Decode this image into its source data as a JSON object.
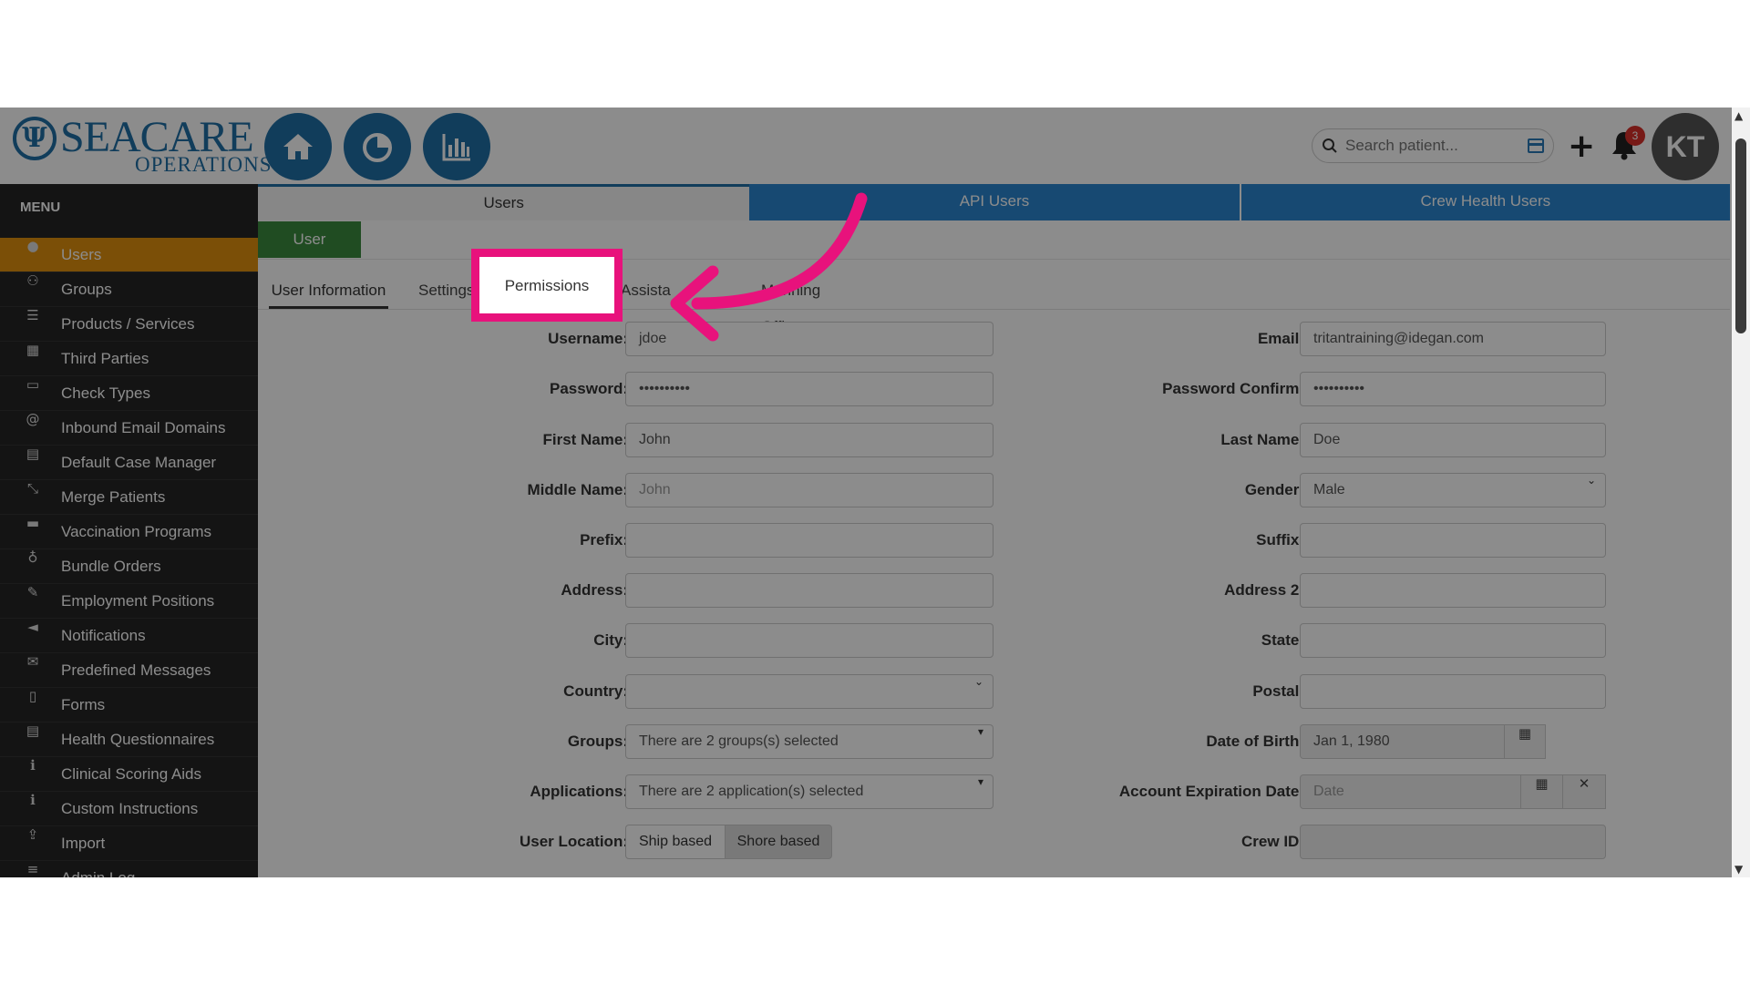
{
  "brand": {
    "logo_mark": "Ψ",
    "name": "SEACARE",
    "sub": "OPERATIONS"
  },
  "header": {
    "search_placeholder": "Search patient...",
    "plus": "+",
    "notification_count": "3",
    "avatar_initials": "KT"
  },
  "sidebar": {
    "title": "MENU",
    "items": [
      {
        "label": "Users",
        "icon": "user-icon",
        "glyph": "●"
      },
      {
        "label": "Groups",
        "icon": "users-icon",
        "glyph": "⚇"
      },
      {
        "label": "Products / Services",
        "icon": "list-icon",
        "glyph": "☰"
      },
      {
        "label": "Third Parties",
        "icon": "building-icon",
        "glyph": "▦"
      },
      {
        "label": "Check Types",
        "icon": "money-icon",
        "glyph": "▭"
      },
      {
        "label": "Inbound Email Domains",
        "icon": "at-icon",
        "glyph": "@"
      },
      {
        "label": "Default Case Manager",
        "icon": "id-card-icon",
        "glyph": "▤"
      },
      {
        "label": "Merge Patients",
        "icon": "compress-icon",
        "glyph": "⤡"
      },
      {
        "label": "Vaccination Programs",
        "icon": "briefcase-icon",
        "glyph": "▬"
      },
      {
        "label": "Bundle Orders",
        "icon": "stethoscope-icon",
        "glyph": "♁"
      },
      {
        "label": "Employment Positions",
        "icon": "wrench-icon",
        "glyph": "✎"
      },
      {
        "label": "Notifications",
        "icon": "bullhorn-icon",
        "glyph": "◄"
      },
      {
        "label": "Predefined Messages",
        "icon": "envelope-icon",
        "glyph": "✉"
      },
      {
        "label": "Forms",
        "icon": "file-icon",
        "glyph": "▯"
      },
      {
        "label": "Health Questionnaires",
        "icon": "list-alt-icon",
        "glyph": "▤"
      },
      {
        "label": "Clinical Scoring Aids",
        "icon": "info-icon",
        "glyph": "ℹ"
      },
      {
        "label": "Custom Instructions",
        "icon": "info-circle-icon",
        "glyph": "ℹ"
      },
      {
        "label": "Import",
        "icon": "upload-icon",
        "glyph": "⇪"
      },
      {
        "label": "Admin Log",
        "icon": "sort-icon",
        "glyph": "≡"
      }
    ]
  },
  "tabs": {
    "t1": "Users",
    "t2": "API Users",
    "t3": "Crew Health Users"
  },
  "user_button": "User",
  "sub_tabs": {
    "user_info": "User Information",
    "settings": "Settings",
    "permissions": "Permissions",
    "assistant": "Assista",
    "manning": "Manning Office"
  },
  "form": {
    "username": {
      "label": "Username:",
      "value": "jdoe"
    },
    "email": {
      "label": "Email:",
      "value": "tritantraining@idegan.com"
    },
    "password": {
      "label": "Password:",
      "value": "••••••••••"
    },
    "password_confirm": {
      "label": "Password Confirm:",
      "value": "••••••••••"
    },
    "first_name": {
      "label": "First Name:",
      "value": "John"
    },
    "last_name": {
      "label": "Last Name:",
      "value": "Doe"
    },
    "middle_name": {
      "label": "Middle Name:",
      "placeholder": "John"
    },
    "gender": {
      "label": "Gender:",
      "value": "Male"
    },
    "prefix": {
      "label": "Prefix:"
    },
    "suffix": {
      "label": "Suffix:"
    },
    "address": {
      "label": "Address:"
    },
    "address2": {
      "label": "Address 2:"
    },
    "city": {
      "label": "City:"
    },
    "state": {
      "label": "State:"
    },
    "country": {
      "label": "Country:"
    },
    "postal": {
      "label": "Postal:"
    },
    "groups": {
      "label": "Groups:",
      "value": "There are 2 groups(s) selected"
    },
    "dob": {
      "label": "Date of Birth:",
      "value": "Jan 1, 1980"
    },
    "applications": {
      "label": "Applications:",
      "value": "There are 2 application(s) selected"
    },
    "expiration": {
      "label": "Account Expiration Date:",
      "placeholder": "Date"
    },
    "location": {
      "label": "User Location:",
      "options": [
        "Ship based",
        "Shore based"
      ],
      "selected": "Shore based"
    },
    "crew_id": {
      "label": "Crew ID:"
    }
  },
  "colors": {
    "brand_blue": "#1f6fa6",
    "tab_blue": "#2a86d0",
    "green": "#3b8a3e",
    "orange": "#e0900e",
    "highlight": "#e8127c"
  }
}
